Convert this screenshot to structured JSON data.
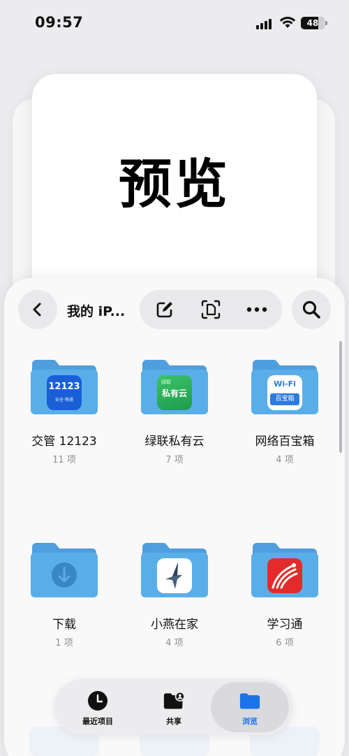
{
  "status_bar": {
    "time": "09:57",
    "battery": "48"
  },
  "preview": {
    "title": "预览"
  },
  "nav": {
    "title": "我的 iP..."
  },
  "folders": [
    {
      "name": "交管 12123",
      "count": "11 项",
      "badge": "12123",
      "badge_sub": "安全·畅通"
    },
    {
      "name": "绿联私有云",
      "count": "7 项",
      "badge": "私有云",
      "badge_sub": "绿联"
    },
    {
      "name": "网络百宝箱",
      "count": "4 项",
      "badge": "Wi-Fi",
      "badge_sub": "百宝箱"
    },
    {
      "name": "下载",
      "count": "1 项"
    },
    {
      "name": "小燕在家",
      "count": "4 项"
    },
    {
      "name": "学习通",
      "count": "6 项"
    }
  ],
  "tabs": [
    {
      "label": "最近项目"
    },
    {
      "label": "共享"
    },
    {
      "label": "浏览"
    }
  ],
  "colors": {
    "folder": "#5aa9e6",
    "folder_dark": "#4f9ede",
    "accent": "#1a73e8"
  }
}
